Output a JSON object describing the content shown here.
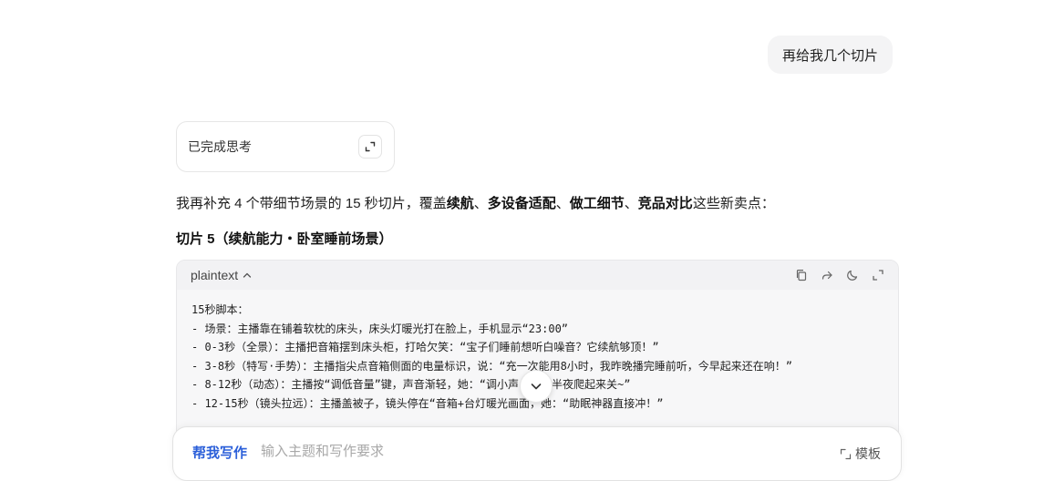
{
  "user_message": "再给我几个切片",
  "thinking": {
    "label": "已完成思考"
  },
  "intro": {
    "p1": "我再补充 4 个带细节场景的 15 秒切片，覆盖",
    "b1": "续航",
    "s1": "、",
    "b2": "多设备适配",
    "s2": "、",
    "b3": "做工细节",
    "s3": "、",
    "b4": "竞品对比",
    "p2": "这些新卖点："
  },
  "section_title": "切片 5（续航能力・卧室睡前场景）",
  "code_block": {
    "language": "plaintext",
    "lines": [
      "15秒脚本：",
      "- 场景：主播靠在铺着软枕的床头，床头灯暖光打在脸上，手机显示“23:00”",
      "- 0-3秒（全景）：主播把音箱摆到床头柜，打哈欠笑：“宝子们睡前想听白噪音？它续航够顶！”",
      "- 3-8秒（特写·手势）：主播指尖点音箱侧面的电量标识，说：“充一次能用8小时，我昨晚播完睡前听，今早起来还在响！”",
      "- 8-12秒（动态）：主播按“调低音量”键，声音渐轻，她：“调小声，不用半夜爬起来关~”",
      "- 12-15秒（镜头拉远）：主播盖被子，镜头停在“音箱+台灯暖光画面，她：“助眠神器直接冲！”"
    ]
  },
  "icons": {
    "expand": "expand-icon",
    "chevron_up": "chevron-up-icon",
    "copy": "copy-icon",
    "share": "share-icon",
    "theme": "moon-icon",
    "fullscreen": "fullscreen-icon",
    "scroll_down": "chevron-down-icon",
    "template": "template-icon"
  },
  "composer": {
    "mode_label": "帮我写作",
    "placeholder": "输入主题和写作要求",
    "template_label": "模板"
  },
  "colors": {
    "accent": "#2b5fd9"
  }
}
